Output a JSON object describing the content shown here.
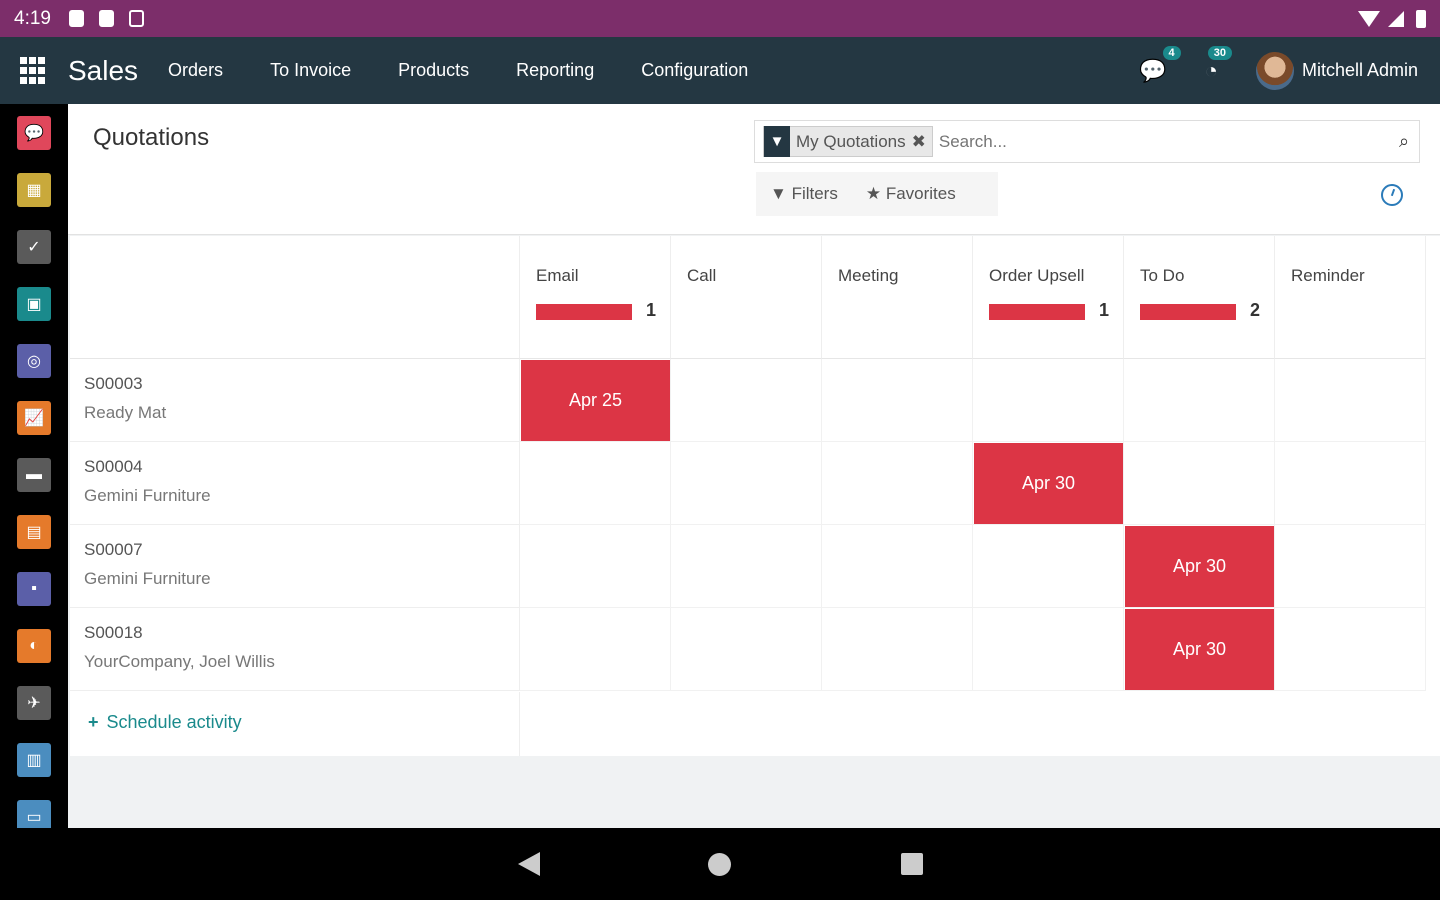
{
  "statusbar": {
    "time": "4:19"
  },
  "nav": {
    "brand": "Sales",
    "menu": [
      "Orders",
      "To Invoice",
      "Products",
      "Reporting",
      "Configuration"
    ],
    "messages_count": "4",
    "activities_count": "30",
    "user": "Mitchell Admin"
  },
  "sidebar_apps": [
    {
      "name": "discuss",
      "color": "#e0475b",
      "glyph": "💬"
    },
    {
      "name": "calendar",
      "color": "#c9a93b",
      "glyph": "▦"
    },
    {
      "name": "todo",
      "color": "#5a5a5a",
      "glyph": "✓"
    },
    {
      "name": "contacts",
      "color": "#1a8a8c",
      "glyph": "▣"
    },
    {
      "name": "crm",
      "color": "#5b5fa8",
      "glyph": "◎"
    },
    {
      "name": "sales",
      "color": "#e57a2b",
      "glyph": "📈"
    },
    {
      "name": "pos",
      "color": "#5a5a5a",
      "glyph": "▬"
    },
    {
      "name": "invoicing",
      "color": "#e57a2b",
      "glyph": "▤"
    },
    {
      "name": "inventory",
      "color": "#5b5fa8",
      "glyph": "▪"
    },
    {
      "name": "website",
      "color": "#e57a2b",
      "glyph": "◐"
    },
    {
      "name": "marketing",
      "color": "#5a5a5a",
      "glyph": "✈"
    },
    {
      "name": "documents",
      "color": "#4b8dbf",
      "glyph": "▥"
    },
    {
      "name": "settings",
      "color": "#4b8dbf",
      "glyph": "▭"
    }
  ],
  "page": {
    "title": "Quotations"
  },
  "search": {
    "facet": "My Quotations",
    "placeholder": "Search...",
    "filters_label": "Filters",
    "favorites_label": "Favorites"
  },
  "activity_types": [
    {
      "name": "Email",
      "count": "1",
      "has_bar": true
    },
    {
      "name": "Call",
      "count": "",
      "has_bar": false
    },
    {
      "name": "Meeting",
      "count": "",
      "has_bar": false
    },
    {
      "name": "Order Upsell",
      "count": "1",
      "has_bar": true
    },
    {
      "name": "To Do",
      "count": "2",
      "has_bar": true
    },
    {
      "name": "Reminder",
      "count": "",
      "has_bar": false
    }
  ],
  "records": [
    {
      "ref": "S00003",
      "partner": "Ready Mat",
      "activity_col": 0,
      "date": "Apr 25"
    },
    {
      "ref": "S00004",
      "partner": "Gemini Furniture",
      "activity_col": 3,
      "date": "Apr 30"
    },
    {
      "ref": "S00007",
      "partner": "Gemini Furniture",
      "activity_col": 4,
      "date": "Apr 30"
    },
    {
      "ref": "S00018",
      "partner": "YourCompany, Joel Willis",
      "activity_col": 4,
      "date": "Apr 30"
    }
  ],
  "schedule_label": "Schedule activity",
  "colors": {
    "overdue": "#dc3545",
    "accent": "#1a8a8c",
    "navbar": "#243742",
    "statusbar": "#7c2e6a"
  }
}
